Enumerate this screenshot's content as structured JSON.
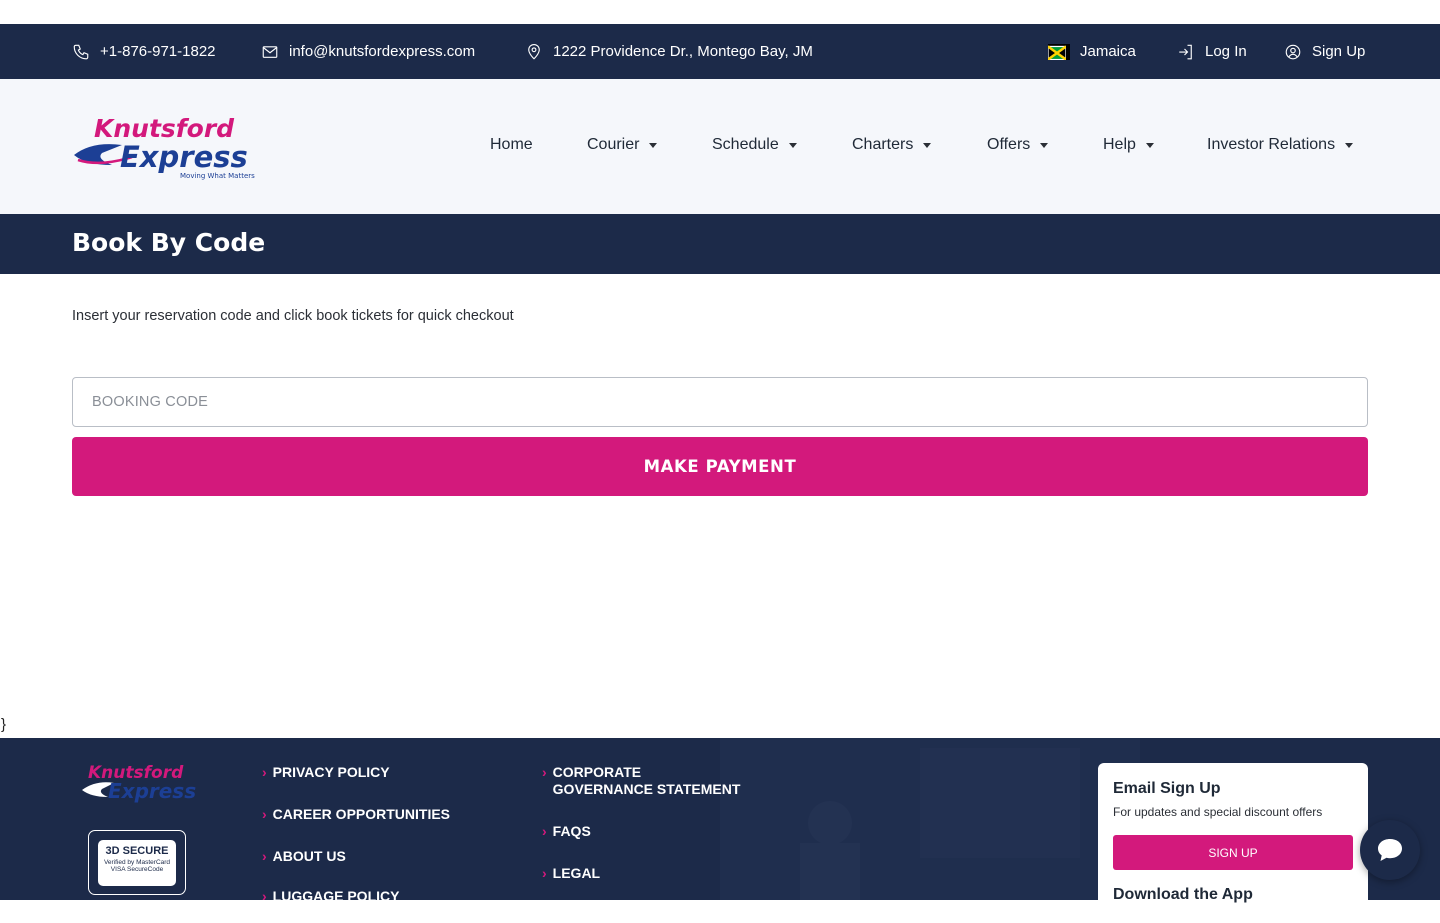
{
  "topbar": {
    "phone": "+1-876-971-1822",
    "email": "info@knutsfordexpress.com",
    "address": "1222 Providence Dr., Montego Bay, JM",
    "country": "Jamaica",
    "login": "Log In",
    "signup": "Sign Up"
  },
  "brand": {
    "name_line1": "Knutsford",
    "name_line2": "Express",
    "tagline": "Moving What Matters"
  },
  "nav": {
    "items": [
      "Home",
      "Courier",
      "Schedule",
      "Charters",
      "Offers",
      "Help",
      "Investor Relations"
    ]
  },
  "page": {
    "title": "Book By Code",
    "instructions": "Insert your reservation code and click book tickets for quick checkout",
    "code_placeholder": "BOOKING CODE",
    "pay_label": "MAKE PAYMENT",
    "stray_text": "}"
  },
  "footer": {
    "secure_badge_title": "3D SECURE",
    "secure_badge_sub": "Verified by MasterCard VISA SecureCode",
    "links_col1": [
      "PRIVACY POLICY",
      "CAREER OPPORTUNITIES",
      "ABOUT US",
      "LUGGAGE POLICY"
    ],
    "links_col2": [
      "CORPORATE GOVERNANCE STATEMENT",
      "FAQS",
      "LEGAL"
    ],
    "email_signup_title": "Email Sign Up",
    "email_signup_sub": "For updates and special discount offers",
    "signup_button": "SIGN UP",
    "download_title": "Download the App"
  },
  "colors": {
    "navy": "#1c2a49",
    "accent": "#d3197c",
    "header_bg": "#f5f7fb"
  }
}
